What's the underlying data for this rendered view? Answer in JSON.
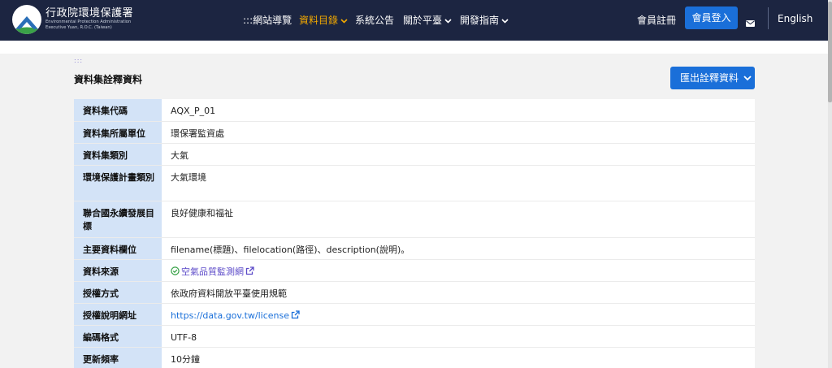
{
  "header": {
    "brand_main": "行政院環境保護署",
    "brand_sub_line1": "Environmental Protection Administration",
    "brand_sub_line2": "Executive Yuan, R.O.C. (Taiwan)",
    "nav": [
      {
        "label": ":::網站導覽"
      },
      {
        "label": "資料目錄"
      },
      {
        "label": "系統公告"
      },
      {
        "label": "關於平臺"
      },
      {
        "label": "開發指南"
      }
    ],
    "register_label": "會員註冊",
    "login_label": "會員登入",
    "language_label": "English"
  },
  "colors": {
    "header_bg": "#1c2541",
    "accent": "#1a6fd9",
    "nav_active": "#f2a900",
    "key_cell_bg": "#d3e3f7"
  },
  "main": {
    "accesskey": ":::",
    "title": "資料集詮釋資料",
    "export_label": "匯出詮釋資料",
    "rows": [
      {
        "key": "資料集代碼",
        "value": "AQX_P_01"
      },
      {
        "key": "資料集所屬單位",
        "value": "環保署監資處"
      },
      {
        "key": "資料集類別",
        "value": "大氣"
      },
      {
        "key": "環境保護計畫類別",
        "value": "大氣環境"
      },
      {
        "key": "聯合國永續發展目標",
        "value": "良好健康和福祉"
      },
      {
        "key": "主要資料欄位",
        "value": "filename(標題)、filelocation(路徑)、description(說明)。"
      },
      {
        "key": "資料來源",
        "value": "空氣品質監測網"
      },
      {
        "key": "授權方式",
        "value": "依政府資料開放平臺使用規範"
      },
      {
        "key": "授權說明網址",
        "value": "https://data.gov.tw/license"
      },
      {
        "key": "編碼格式",
        "value": "UTF-8"
      },
      {
        "key": "更新頻率",
        "value": "10分鐘"
      }
    ]
  }
}
